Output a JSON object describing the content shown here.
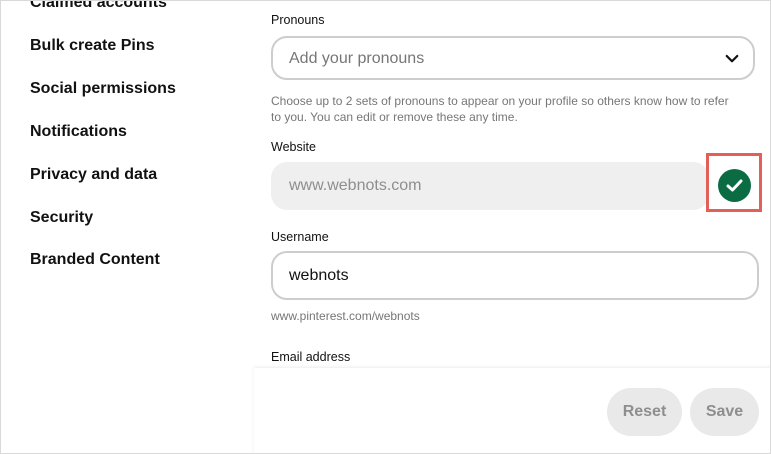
{
  "sidebar": {
    "items": [
      {
        "label": "Claimed accounts"
      },
      {
        "label": "Bulk create Pins"
      },
      {
        "label": "Social permissions"
      },
      {
        "label": "Notifications"
      },
      {
        "label": "Privacy and data"
      },
      {
        "label": "Security"
      },
      {
        "label": "Branded Content"
      }
    ]
  },
  "form": {
    "pronouns": {
      "label": "Pronouns",
      "placeholder": "Add your pronouns",
      "helper_line1": "Choose up to 2 sets of pronouns to appear on your profile so others know how to refer",
      "helper_line2": "to you. You can edit or remove these any time."
    },
    "website": {
      "label": "Website",
      "value": "www.webnots.com",
      "status": "verified",
      "status_color": "#0b6b43"
    },
    "username": {
      "label": "Username",
      "value": "webnots",
      "helper": "www.pinterest.com/webnots"
    },
    "email": {
      "label": "Email address"
    }
  },
  "footer": {
    "reset_label": "Reset",
    "save_label": "Save"
  },
  "colors": {
    "highlight_border": "#e26058",
    "button_bg": "#e9e9e9"
  }
}
